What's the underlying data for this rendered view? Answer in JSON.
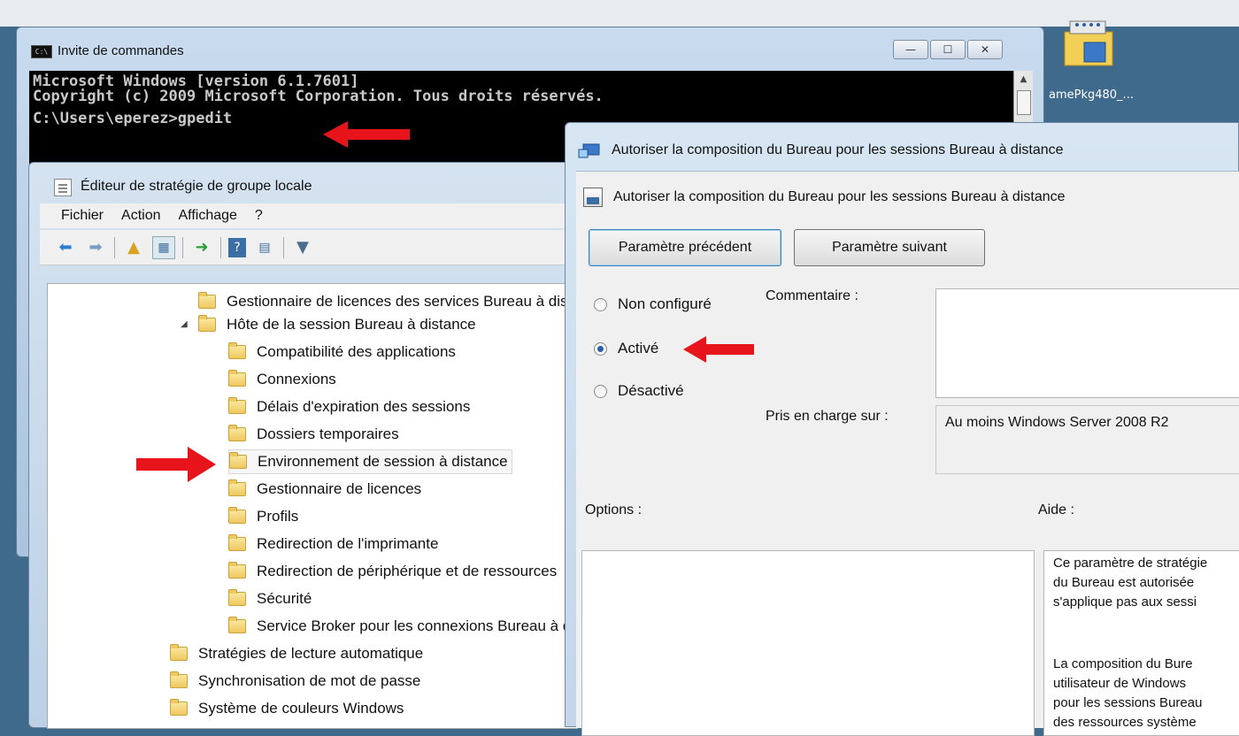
{
  "desktop": {
    "icon_label": "amePkg480_..."
  },
  "cmd": {
    "title": "Invite de commandes",
    "lines": [
      "Microsoft Windows [version 6.1.7601]",
      "Copyright (c) 2009 Microsoft Corporation. Tous droits réservés.",
      "",
      "C:\\Users\\eperez>gpedit"
    ],
    "buttons": {
      "minimize": "—",
      "maximize": "☐",
      "close": "✕"
    }
  },
  "gpedit": {
    "title": "Éditeur de stratégie de groupe locale",
    "menu": [
      "Fichier",
      "Action",
      "Affichage",
      "?"
    ],
    "tree": [
      {
        "label": "Gestionnaire de licences des services Bureau à distance"
      },
      {
        "label": "Hôte de la session Bureau à distance",
        "expanded": true
      },
      {
        "label": "Compatibilité des applications"
      },
      {
        "label": "Connexions"
      },
      {
        "label": "Délais d'expiration des sessions"
      },
      {
        "label": "Dossiers temporaires"
      },
      {
        "label": "Environnement de session à distance",
        "selected": true
      },
      {
        "label": "Gestionnaire de licences"
      },
      {
        "label": "Profils"
      },
      {
        "label": "Redirection de l'imprimante"
      },
      {
        "label": "Redirection de périphérique et de ressources"
      },
      {
        "label": "Sécurité"
      },
      {
        "label": "Service Broker pour les connexions Bureau à distance"
      },
      {
        "label": "Stratégies de lecture automatique"
      },
      {
        "label": "Synchronisation de mot de passe"
      },
      {
        "label": "Système de couleurs Windows"
      }
    ]
  },
  "dialog": {
    "title": "Autoriser la composition du Bureau pour les sessions Bureau à distance",
    "header": "Autoriser la composition du Bureau pour les sessions Bureau à distance",
    "prev_button": "Paramètre précédent",
    "next_button": "Paramètre suivant",
    "radios": [
      {
        "label": "Non configuré",
        "checked": false
      },
      {
        "label": "Activé",
        "checked": true
      },
      {
        "label": "Désactivé",
        "checked": false
      }
    ],
    "comment_label": "Commentaire :",
    "supported_label": "Pris en charge sur :",
    "supported_value": "Au moins Windows Server 2008 R2",
    "options_label": "Options :",
    "help_label": "Aide :",
    "help_lines": [
      "Ce paramètre de stratégie",
      "du Bureau est autorisée",
      "s'applique pas aux sessi",
      "",
      "La composition du Bure",
      "utilisateur de Windows",
      "pour les sessions Bureau",
      "des ressources système"
    ]
  },
  "colors": {
    "arrow": "#e8141b",
    "accent": "#2a5ea8"
  }
}
